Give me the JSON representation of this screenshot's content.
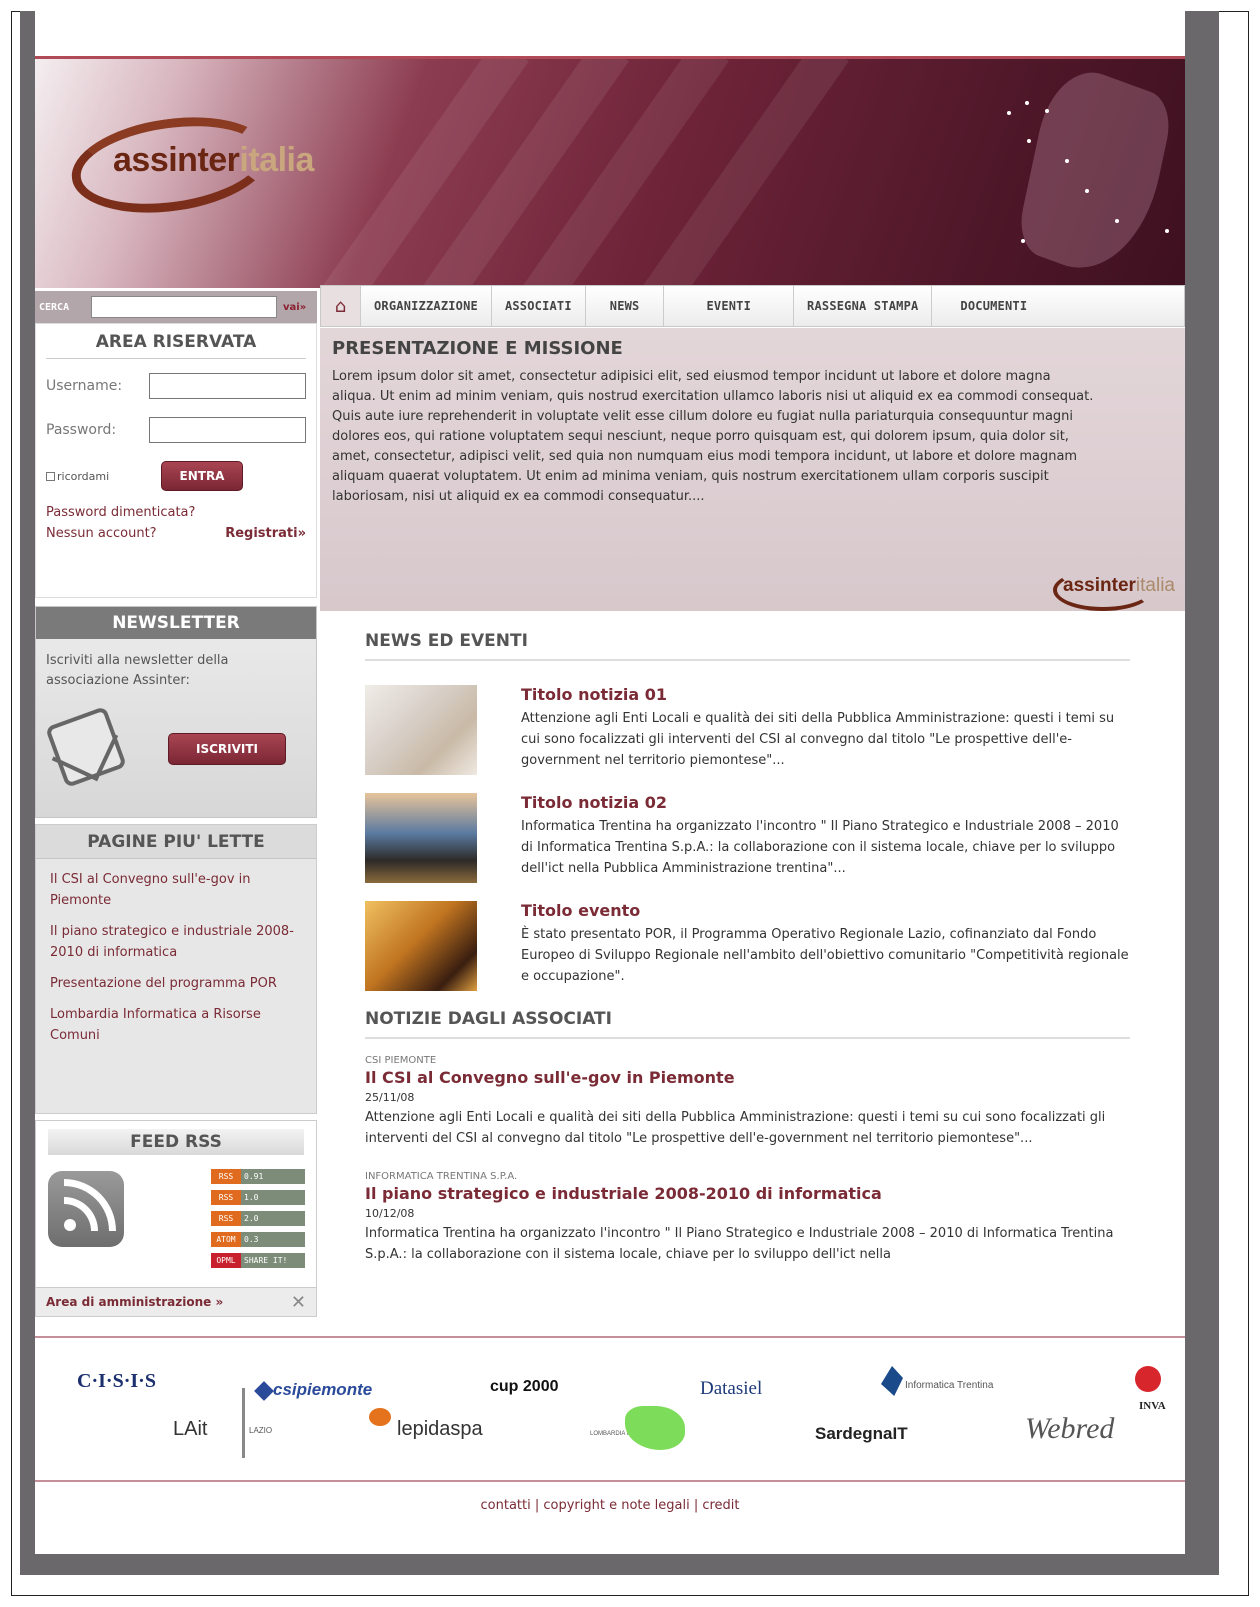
{
  "search": {
    "label": "CERCA",
    "go": "vai»",
    "value": ""
  },
  "logo": {
    "part1": "assinter",
    "part2": "italia"
  },
  "nav": {
    "items": [
      "ORGANIZZAZIONE",
      "ASSOCIATI",
      "NEWS",
      "EVENTI",
      "RASSEGNA STAMPA",
      "DOCUMENTI"
    ]
  },
  "login": {
    "title": "AREA RISERVATA",
    "username_label": "Username:",
    "password_label": "Password:",
    "remember": "ricordami",
    "submit": "ENTRA",
    "forgot": "Password dimenticata?",
    "no_account": "Nessun account?",
    "register": "Registrati»"
  },
  "newsletter": {
    "title": "NEWSLETTER",
    "text": "Iscriviti alla newsletter della associazione Assinter:",
    "button": "ISCRIVITI"
  },
  "most_read": {
    "title": "PAGINE PIU' LETTE",
    "items": [
      "Il CSI al Convegno sull'e-gov in Piemonte",
      "Il piano strategico e industriale 2008-2010 di informatica",
      "Presentazione del programma POR",
      "Lombardia Informatica a Risorse Comuni"
    ]
  },
  "rss": {
    "title": "FEED RSS",
    "badges": [
      {
        "k": "RSS",
        "v": "0.91"
      },
      {
        "k": "RSS",
        "v": "1.0"
      },
      {
        "k": "RSS",
        "v": "2.0"
      },
      {
        "k": "ATOM",
        "v": "0.3"
      },
      {
        "k": "OPML",
        "v": "SHARE IT!"
      }
    ]
  },
  "admin": {
    "label": "Area di amministrazione »"
  },
  "presentation": {
    "title": "PRESENTAZIONE E MISSIONE",
    "text": "Lorem ipsum dolor sit amet, consectetur adipisici elit, sed eiusmod tempor incidunt ut labore et dolore magna aliqua. Ut enim ad minim veniam, quis nostrud exercitation ullamco laboris nisi ut aliquid ex ea commodi consequat. Quis aute iure reprehenderit in voluptate velit esse cillum dolore eu fugiat nulla pariaturquia consequuntur magni dolores eos, qui ratione voluptatem sequi nesciunt, neque porro quisquam est, qui dolorem ipsum, quia dolor sit, amet, consectetur, adipisci velit, sed quia non numquam eius modi tempora incidunt, ut labore et dolore magnam aliquam quaerat voluptatem. Ut enim ad minima veniam, quis nostrum exercitationem ullam corporis suscipit laboriosam, nisi ut aliquid ex ea commodi consequatur...."
  },
  "news": {
    "title": "NEWS ED EVENTI",
    "items": [
      {
        "title": "Titolo notizia 01",
        "text": "Attenzione agli Enti Locali e qualità dei siti della Pubblica Amministrazione: questi i temi su cui sono focalizzati gli interventi del CSI al convegno dal titolo \"Le prospettive dell'e-government nel territorio piemontese\"..."
      },
      {
        "title": "Titolo notizia 02",
        "text": "Informatica Trentina ha organizzato l'incontro \" Il Piano Strategico e Industriale 2008 – 2010 di Informatica Trentina S.p.A.: la collaborazione con il sistema locale, chiave per lo sviluppo dell'ict nella Pubblica Amministrazione trentina\"..."
      },
      {
        "title": "Titolo evento",
        "text": "È stato presentato POR, il Programma Operativo Regionale Lazio, cofinanziato dal Fondo Europeo di Sviluppo Regionale nell'ambito dell'obiettivo comunitario \"Competitività regionale e occupazione\"."
      }
    ]
  },
  "associates": {
    "title": "NOTIZIE DAGLI ASSOCIATI",
    "items": [
      {
        "source": "CSI PIEMONTE",
        "title": "Il CSI al Convegno sull'e-gov in Piemonte",
        "date": "25/11/08",
        "text": "Attenzione agli Enti Locali e qualità dei siti della Pubblica Amministrazione: questi i temi su cui sono focalizzati gli interventi del CSI al convegno dal titolo \"Le prospettive dell'e-government nel territorio piemontese\"..."
      },
      {
        "source": "INFORMATICA TRENTINA S.P.A.",
        "title": "Il piano strategico e industriale 2008-2010 di informatica",
        "date": "10/12/08",
        "text": "Informatica Trentina ha organizzato l'incontro \" Il Piano Strategico e Industriale 2008 – 2010 di Informatica Trentina S.p.A.: la collaborazione con il sistema locale, chiave per lo sviluppo dell'ict nella"
      }
    ]
  },
  "partners": {
    "cisis": "C·I·S·I·S",
    "csi": "csipiemonte",
    "cup": "cup 2000",
    "datasiel": "Datasiel",
    "itrentina": "Informatica Trentina",
    "insiel": "INVA",
    "lait": "LAit",
    "lazio": "LAZIO",
    "lepida": "lepidaspa",
    "lombardia": "LOMBARDIA INFORMATICA",
    "sardegna": "SardegnaIT",
    "webred": "Webred"
  },
  "footer": {
    "text": "contatti  |  copyright e note legali |  credit"
  }
}
